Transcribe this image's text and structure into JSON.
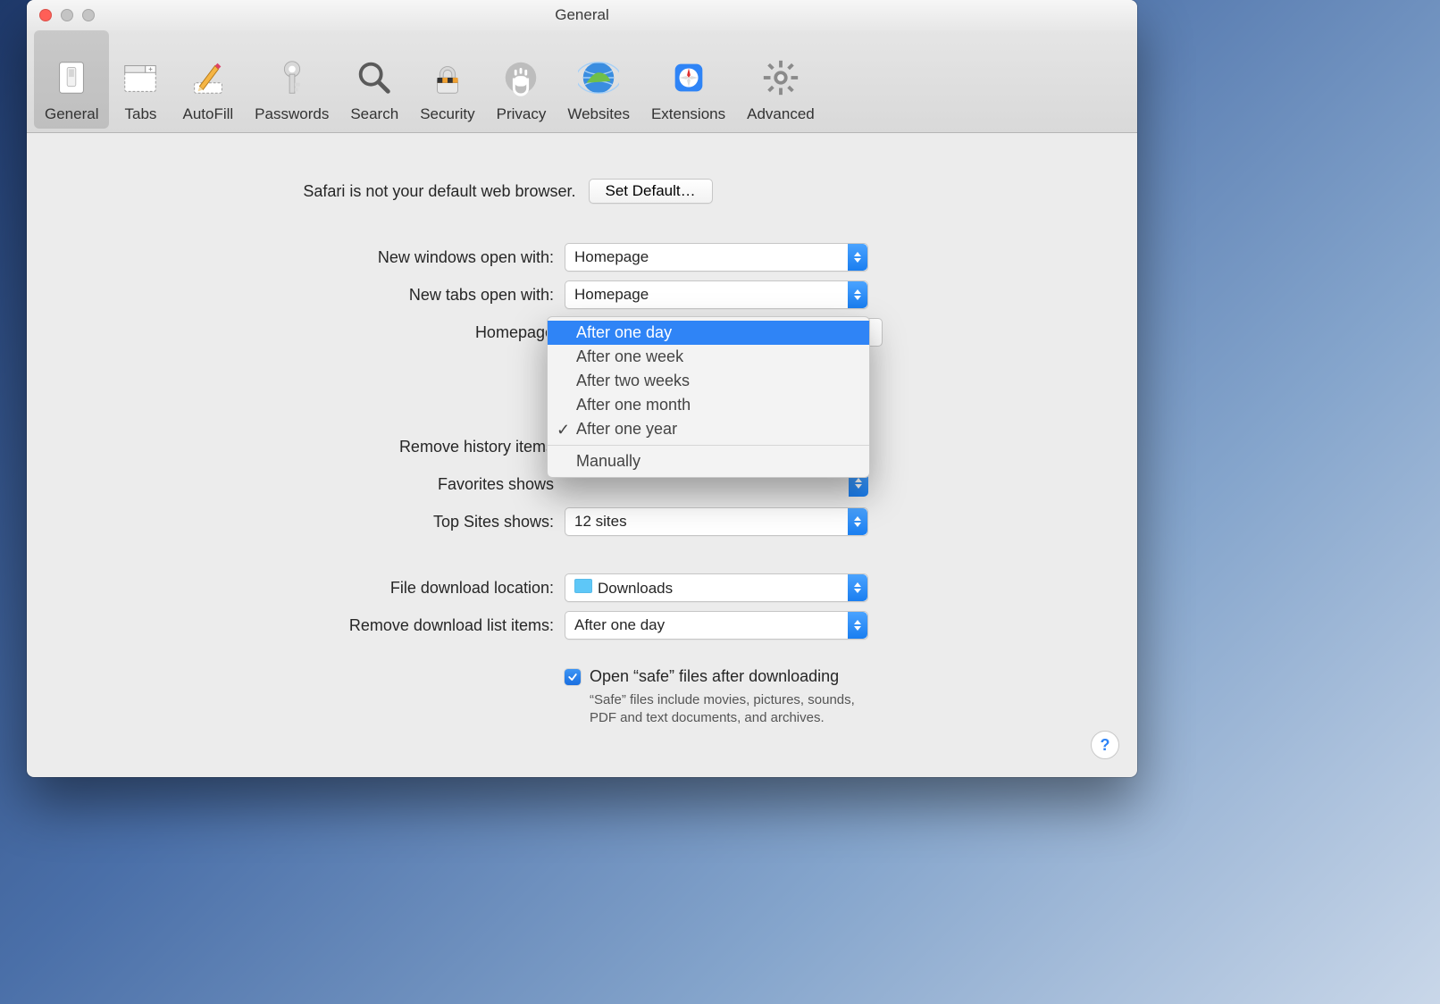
{
  "window": {
    "title": "General"
  },
  "toolbar": {
    "tabs": [
      {
        "id": "general",
        "label": "General"
      },
      {
        "id": "tabs",
        "label": "Tabs"
      },
      {
        "id": "autofill",
        "label": "AutoFill"
      },
      {
        "id": "passwords",
        "label": "Passwords"
      },
      {
        "id": "search",
        "label": "Search"
      },
      {
        "id": "security",
        "label": "Security"
      },
      {
        "id": "privacy",
        "label": "Privacy"
      },
      {
        "id": "websites",
        "label": "Websites"
      },
      {
        "id": "extensions",
        "label": "Extensions"
      },
      {
        "id": "advanced",
        "label": "Advanced"
      }
    ],
    "selected": "general"
  },
  "default_browser": {
    "message": "Safari is not your default web browser.",
    "button": "Set Default…"
  },
  "settings": {
    "new_windows": {
      "label": "New windows open with:",
      "value": "Homepage"
    },
    "new_tabs": {
      "label": "New tabs open with:",
      "value": "Homepage"
    },
    "homepage": {
      "label": "Homepage"
    },
    "remove_history": {
      "label": "Remove history items"
    },
    "favorites_shows": {
      "label": "Favorites shows"
    },
    "top_sites": {
      "label": "Top Sites shows:",
      "value": "12 sites"
    },
    "download_location": {
      "label": "File download location:",
      "value": "Downloads"
    },
    "remove_downloads": {
      "label": "Remove download list items:",
      "value": "After one day"
    },
    "open_safe": {
      "label": "Open “safe” files after downloading",
      "checked": true,
      "help": "“Safe” files include movies, pictures, sounds, PDF and text documents, and archives."
    }
  },
  "dropdown": {
    "highlighted": 0,
    "checked": 4,
    "options": [
      "After one day",
      "After one week",
      "After two weeks",
      "After one month",
      "After one year"
    ],
    "separator_then": "Manually"
  },
  "help_button": "?"
}
